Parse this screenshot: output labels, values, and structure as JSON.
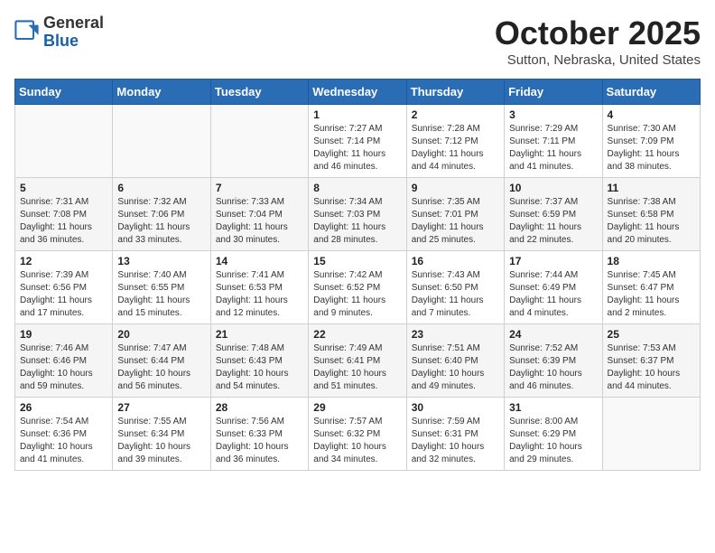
{
  "header": {
    "logo_general": "General",
    "logo_blue": "Blue",
    "month_title": "October 2025",
    "location": "Sutton, Nebraska, United States"
  },
  "weekdays": [
    "Sunday",
    "Monday",
    "Tuesday",
    "Wednesday",
    "Thursday",
    "Friday",
    "Saturday"
  ],
  "weeks": [
    [
      {
        "day": "",
        "info": ""
      },
      {
        "day": "",
        "info": ""
      },
      {
        "day": "",
        "info": ""
      },
      {
        "day": "1",
        "info": "Sunrise: 7:27 AM\nSunset: 7:14 PM\nDaylight: 11 hours\nand 46 minutes."
      },
      {
        "day": "2",
        "info": "Sunrise: 7:28 AM\nSunset: 7:12 PM\nDaylight: 11 hours\nand 44 minutes."
      },
      {
        "day": "3",
        "info": "Sunrise: 7:29 AM\nSunset: 7:11 PM\nDaylight: 11 hours\nand 41 minutes."
      },
      {
        "day": "4",
        "info": "Sunrise: 7:30 AM\nSunset: 7:09 PM\nDaylight: 11 hours\nand 38 minutes."
      }
    ],
    [
      {
        "day": "5",
        "info": "Sunrise: 7:31 AM\nSunset: 7:08 PM\nDaylight: 11 hours\nand 36 minutes."
      },
      {
        "day": "6",
        "info": "Sunrise: 7:32 AM\nSunset: 7:06 PM\nDaylight: 11 hours\nand 33 minutes."
      },
      {
        "day": "7",
        "info": "Sunrise: 7:33 AM\nSunset: 7:04 PM\nDaylight: 11 hours\nand 30 minutes."
      },
      {
        "day": "8",
        "info": "Sunrise: 7:34 AM\nSunset: 7:03 PM\nDaylight: 11 hours\nand 28 minutes."
      },
      {
        "day": "9",
        "info": "Sunrise: 7:35 AM\nSunset: 7:01 PM\nDaylight: 11 hours\nand 25 minutes."
      },
      {
        "day": "10",
        "info": "Sunrise: 7:37 AM\nSunset: 6:59 PM\nDaylight: 11 hours\nand 22 minutes."
      },
      {
        "day": "11",
        "info": "Sunrise: 7:38 AM\nSunset: 6:58 PM\nDaylight: 11 hours\nand 20 minutes."
      }
    ],
    [
      {
        "day": "12",
        "info": "Sunrise: 7:39 AM\nSunset: 6:56 PM\nDaylight: 11 hours\nand 17 minutes."
      },
      {
        "day": "13",
        "info": "Sunrise: 7:40 AM\nSunset: 6:55 PM\nDaylight: 11 hours\nand 15 minutes."
      },
      {
        "day": "14",
        "info": "Sunrise: 7:41 AM\nSunset: 6:53 PM\nDaylight: 11 hours\nand 12 minutes."
      },
      {
        "day": "15",
        "info": "Sunrise: 7:42 AM\nSunset: 6:52 PM\nDaylight: 11 hours\nand 9 minutes."
      },
      {
        "day": "16",
        "info": "Sunrise: 7:43 AM\nSunset: 6:50 PM\nDaylight: 11 hours\nand 7 minutes."
      },
      {
        "day": "17",
        "info": "Sunrise: 7:44 AM\nSunset: 6:49 PM\nDaylight: 11 hours\nand 4 minutes."
      },
      {
        "day": "18",
        "info": "Sunrise: 7:45 AM\nSunset: 6:47 PM\nDaylight: 11 hours\nand 2 minutes."
      }
    ],
    [
      {
        "day": "19",
        "info": "Sunrise: 7:46 AM\nSunset: 6:46 PM\nDaylight: 10 hours\nand 59 minutes."
      },
      {
        "day": "20",
        "info": "Sunrise: 7:47 AM\nSunset: 6:44 PM\nDaylight: 10 hours\nand 56 minutes."
      },
      {
        "day": "21",
        "info": "Sunrise: 7:48 AM\nSunset: 6:43 PM\nDaylight: 10 hours\nand 54 minutes."
      },
      {
        "day": "22",
        "info": "Sunrise: 7:49 AM\nSunset: 6:41 PM\nDaylight: 10 hours\nand 51 minutes."
      },
      {
        "day": "23",
        "info": "Sunrise: 7:51 AM\nSunset: 6:40 PM\nDaylight: 10 hours\nand 49 minutes."
      },
      {
        "day": "24",
        "info": "Sunrise: 7:52 AM\nSunset: 6:39 PM\nDaylight: 10 hours\nand 46 minutes."
      },
      {
        "day": "25",
        "info": "Sunrise: 7:53 AM\nSunset: 6:37 PM\nDaylight: 10 hours\nand 44 minutes."
      }
    ],
    [
      {
        "day": "26",
        "info": "Sunrise: 7:54 AM\nSunset: 6:36 PM\nDaylight: 10 hours\nand 41 minutes."
      },
      {
        "day": "27",
        "info": "Sunrise: 7:55 AM\nSunset: 6:34 PM\nDaylight: 10 hours\nand 39 minutes."
      },
      {
        "day": "28",
        "info": "Sunrise: 7:56 AM\nSunset: 6:33 PM\nDaylight: 10 hours\nand 36 minutes."
      },
      {
        "day": "29",
        "info": "Sunrise: 7:57 AM\nSunset: 6:32 PM\nDaylight: 10 hours\nand 34 minutes."
      },
      {
        "day": "30",
        "info": "Sunrise: 7:59 AM\nSunset: 6:31 PM\nDaylight: 10 hours\nand 32 minutes."
      },
      {
        "day": "31",
        "info": "Sunrise: 8:00 AM\nSunset: 6:29 PM\nDaylight: 10 hours\nand 29 minutes."
      },
      {
        "day": "",
        "info": ""
      }
    ]
  ]
}
